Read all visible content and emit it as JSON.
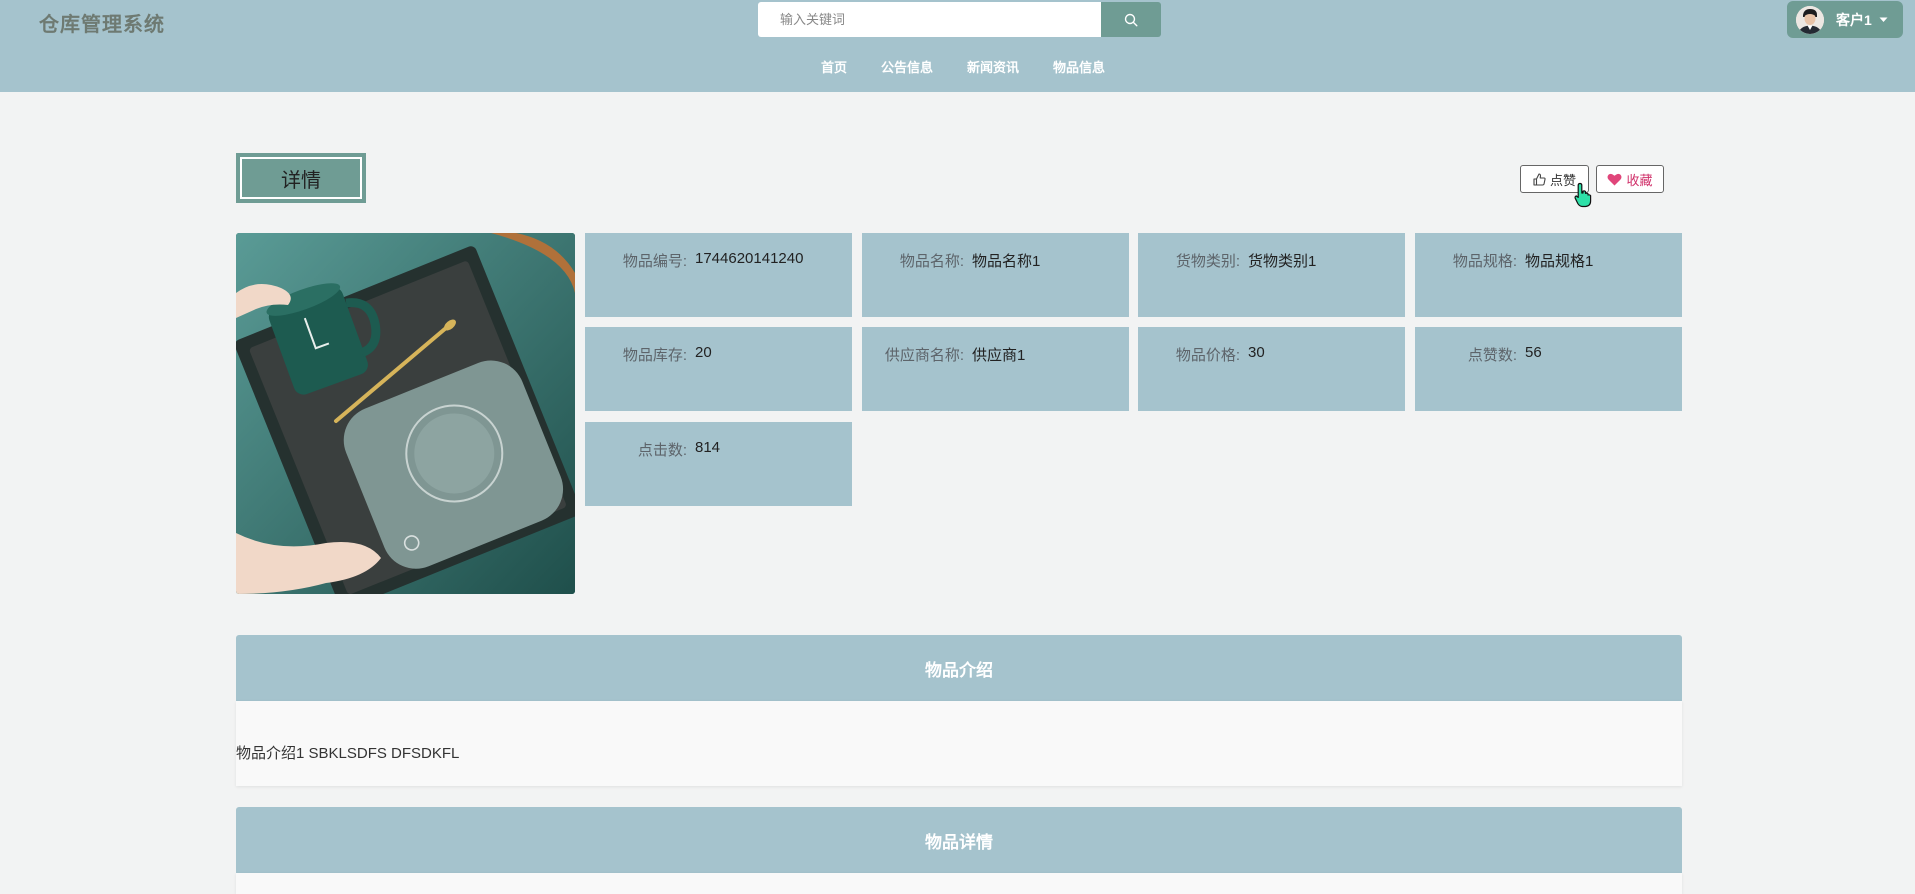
{
  "header": {
    "logo": "仓库管理系统",
    "search": {
      "placeholder": "输入关键词",
      "icon": "search-icon"
    },
    "nav": [
      "首页",
      "公告信息",
      "新闻资讯",
      "物品信息"
    ],
    "user": {
      "name": "客户1",
      "icon": "chevron-down-icon"
    }
  },
  "detail": {
    "title": "详情",
    "like_label": "点赞",
    "fav_label": "收藏",
    "fields": [
      {
        "label": "物品编号:",
        "value": "1744620141240"
      },
      {
        "label": "物品名称:",
        "value": "物品名称1"
      },
      {
        "label": "货物类别:",
        "value": "货物类别1"
      },
      {
        "label": "物品规格:",
        "value": "物品规格1"
      },
      {
        "label": "物品库存:",
        "value": "20"
      },
      {
        "label": "供应商名称:",
        "value": "供应商1"
      },
      {
        "label": "物品价格:",
        "value": "30"
      },
      {
        "label": "点赞数:",
        "value": "56"
      },
      {
        "label": "点击数:",
        "value": "814"
      }
    ]
  },
  "sections": {
    "intro_title": "物品介绍",
    "intro_text": "物品介绍1 SBKLSDFS DFSDKFL",
    "details_title": "物品详情"
  },
  "colors": {
    "header_bg": "#a5c3cd",
    "accent": "#6f9c94",
    "favorite": "#d0306a",
    "page_bg": "#f2f3f3"
  }
}
